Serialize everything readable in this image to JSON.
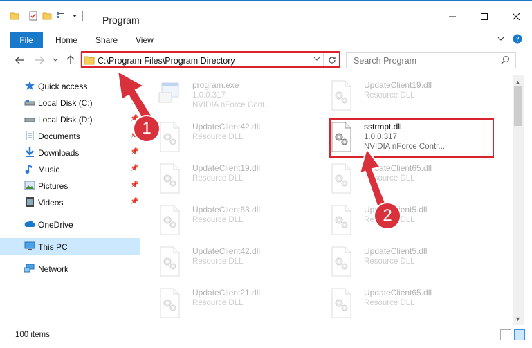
{
  "window": {
    "title": "Program",
    "help_icon": "help-icon"
  },
  "ribbon": {
    "file_label": "File",
    "tabs": [
      "Home",
      "Share",
      "View"
    ]
  },
  "address": {
    "path": "C:\\Program Files\\Program Directory",
    "search_placeholder": "Search Program"
  },
  "sidebar": {
    "items": [
      {
        "label": "Quick access",
        "icon": "star-icon",
        "pinned": false
      },
      {
        "label": "Local Disk (C:)",
        "icon": "drive-icon",
        "pinned": true
      },
      {
        "label": "Local Disk (D:)",
        "icon": "drive-icon",
        "pinned": true
      },
      {
        "label": "Documents",
        "icon": "documents-icon",
        "pinned": true
      },
      {
        "label": "Downloads",
        "icon": "downloads-icon",
        "pinned": true
      },
      {
        "label": "Music",
        "icon": "music-icon",
        "pinned": true
      },
      {
        "label": "Pictures",
        "icon": "pictures-icon",
        "pinned": true
      },
      {
        "label": "Videos",
        "icon": "videos-icon",
        "pinned": true
      },
      {
        "label": "OneDrive",
        "icon": "cloud-icon",
        "pinned": false
      },
      {
        "label": "This PC",
        "icon": "computer-icon",
        "pinned": false,
        "selected": true
      },
      {
        "label": "Network",
        "icon": "network-icon",
        "pinned": false
      }
    ]
  },
  "files": [
    {
      "name": "program.exe",
      "line2": "1.0.0.317",
      "line3": "NVIDIA nForce Cont...",
      "type": "exe",
      "highlighted": false
    },
    {
      "name": "UpdateClient19.dll",
      "line2": "Resource DLL",
      "line3": "",
      "type": "dll",
      "highlighted": false
    },
    {
      "name": "UpdateClient42.dll",
      "line2": "Resource DLL",
      "line3": "",
      "type": "dll",
      "highlighted": false
    },
    {
      "name": "sstrmpt.dll",
      "line2": "1.0.0.317",
      "line3": "NVIDIA nForce Contr...",
      "type": "dll",
      "highlighted": true
    },
    {
      "name": "UpdateClient19.dll",
      "line2": "Resource DLL",
      "line3": "",
      "type": "dll",
      "highlighted": false
    },
    {
      "name": "UpdateClient65.dll",
      "line2": "Resource DLL",
      "line3": "",
      "type": "dll",
      "highlighted": false
    },
    {
      "name": "UpdateClient63.dll",
      "line2": "Resource DLL",
      "line3": "",
      "type": "dll",
      "highlighted": false
    },
    {
      "name": "UpdateClient5.dll",
      "line2": "Resource DLL",
      "line3": "",
      "type": "dll",
      "highlighted": false
    },
    {
      "name": "UpdateClient42.dll",
      "line2": "Resource DLL",
      "line3": "",
      "type": "dll",
      "highlighted": false
    },
    {
      "name": "UpdateClient5.dll",
      "line2": "Resource DLL",
      "line3": "",
      "type": "dll",
      "highlighted": false
    },
    {
      "name": "UpdateClient21.dll",
      "line2": "Resource DLL",
      "line3": "",
      "type": "dll",
      "highlighted": false
    },
    {
      "name": "UpdateClient65.dll",
      "line2": "Resource DLL",
      "line3": "",
      "type": "dll",
      "highlighted": false
    }
  ],
  "status": {
    "item_count": "100 items"
  },
  "annotations": {
    "step1": "1",
    "step2": "2",
    "color": "#d8313c"
  }
}
